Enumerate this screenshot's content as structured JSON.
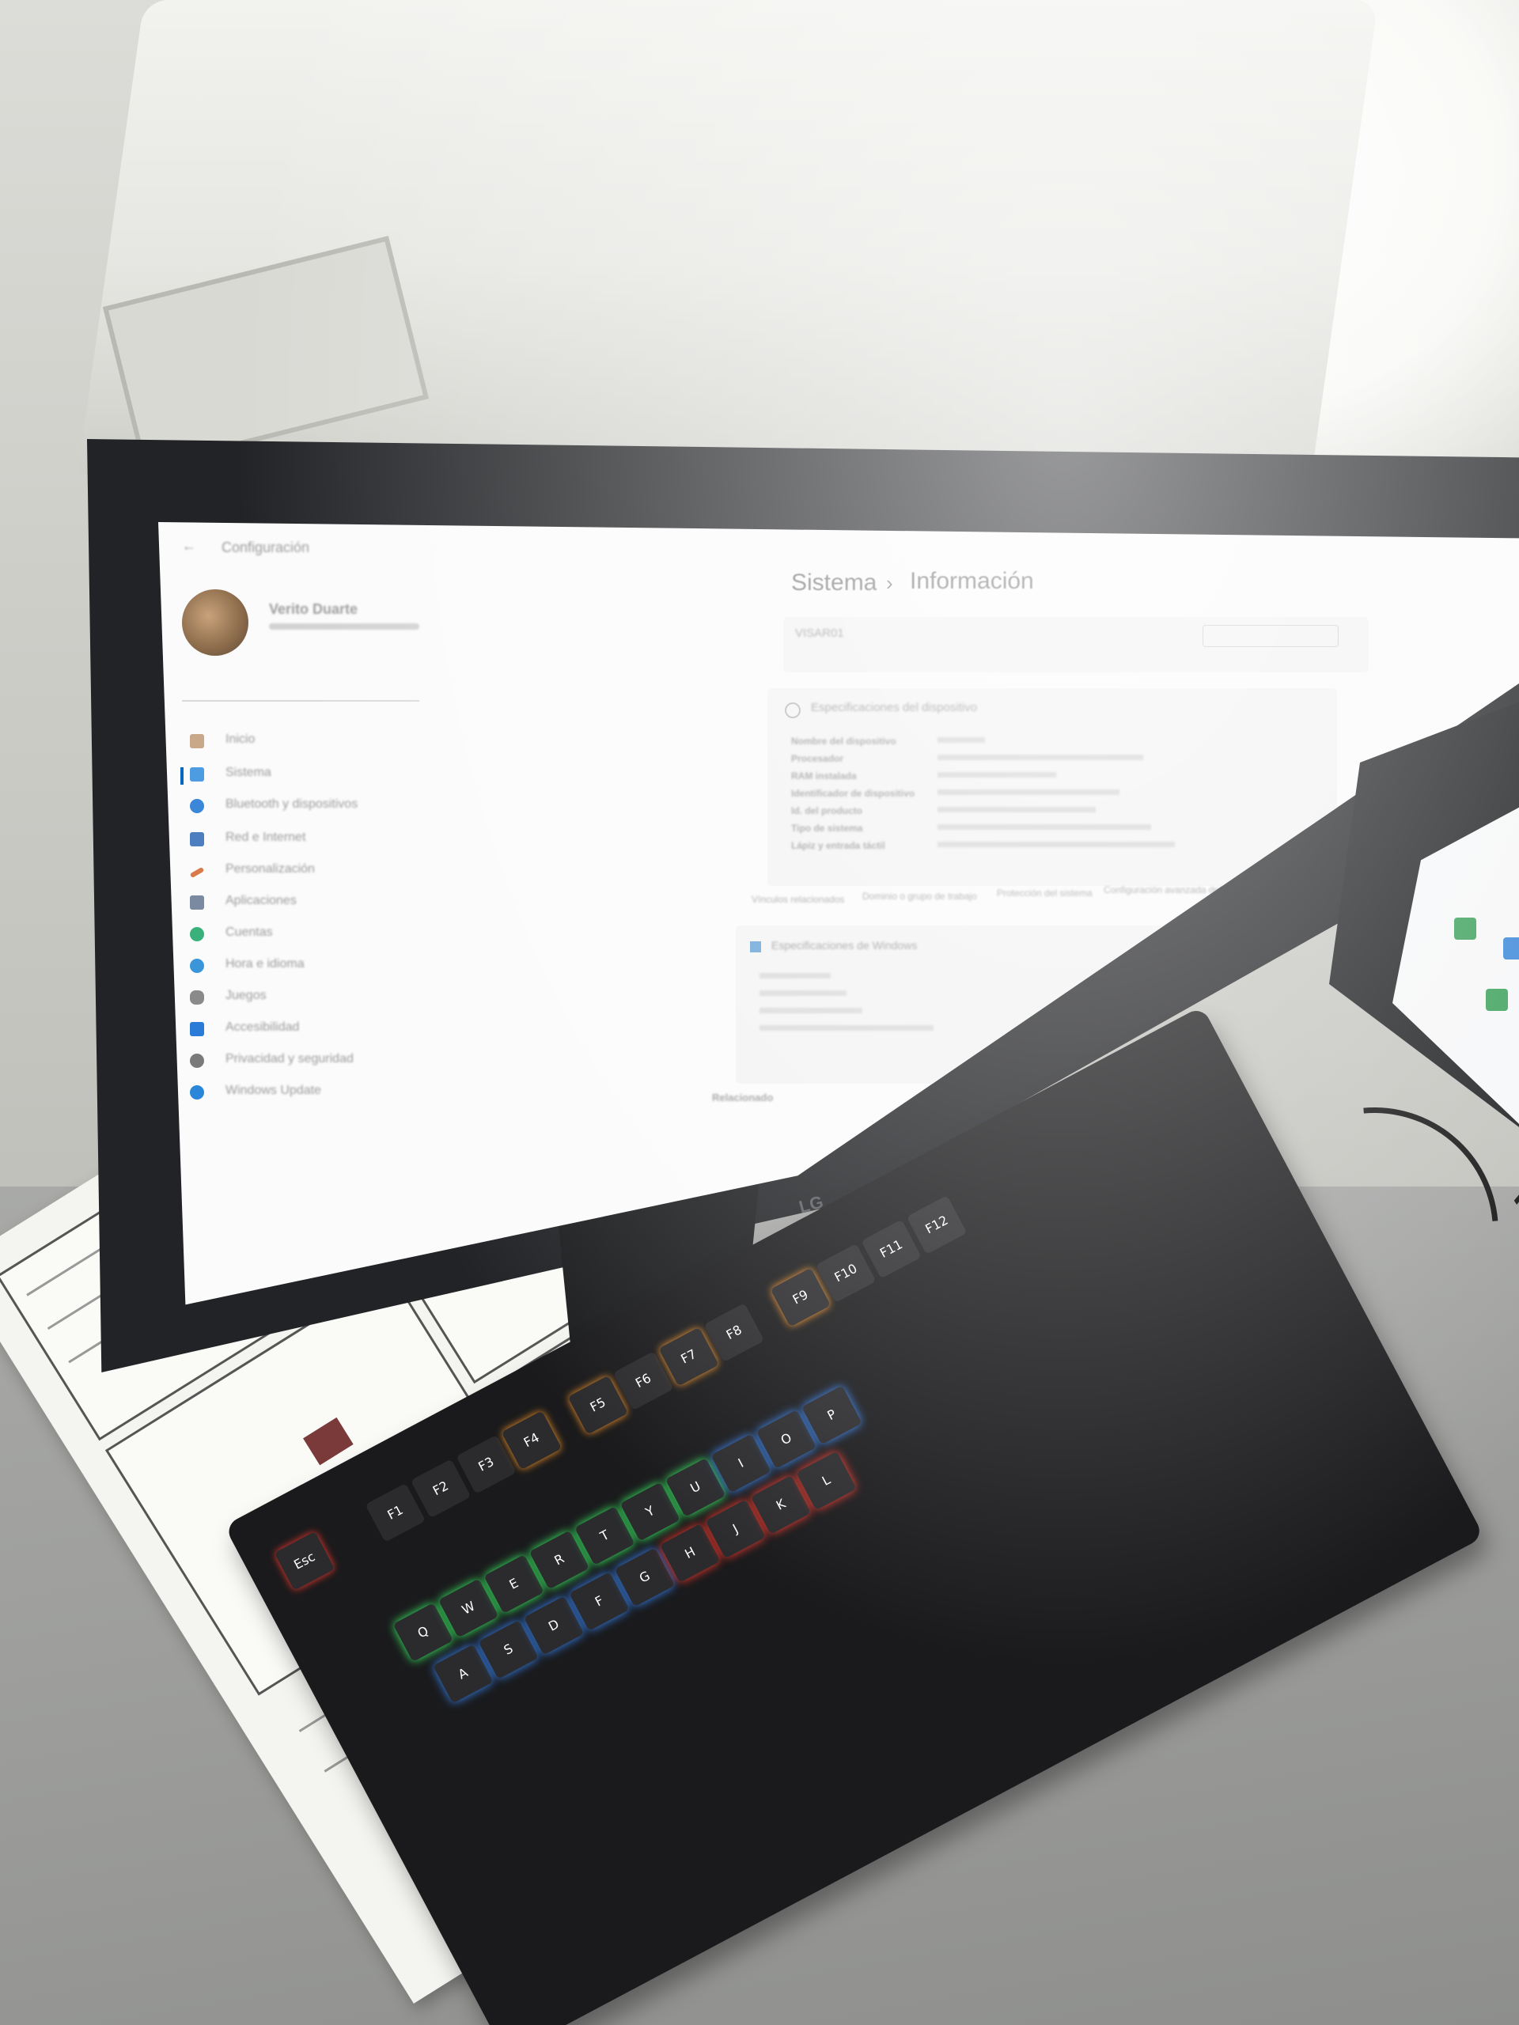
{
  "settings": {
    "app_title": "Configuración",
    "breadcrumb_root": "Sistema",
    "breadcrumb_separator": "›",
    "breadcrumb_page": "Información",
    "user_name": "Verito Duarte",
    "device_name": "VISAR01",
    "spec_section_title": "Especificaciones del dispositivo",
    "windows_section_title": "Especificaciones de Windows",
    "related_title": "Relacionado",
    "spec_labels": [
      "Nombre del dispositivo",
      "Procesador",
      "RAM instalada",
      "Identificador de dispositivo",
      "Id. del producto",
      "Tipo de sistema",
      "Lápiz y entrada táctil"
    ],
    "nav_items": [
      "Inicio",
      "Sistema",
      "Bluetooth y dispositivos",
      "Red e Internet",
      "Personalización",
      "Aplicaciones",
      "Cuentas",
      "Hora e idioma",
      "Juegos",
      "Accesibilidad",
      "Privacidad y seguridad",
      "Windows Update"
    ],
    "tabs": [
      "Vínculos relacionados",
      "Dominio o grupo de trabajo",
      "Protección del sistema",
      "Configuración avanzada del sistema"
    ]
  },
  "keyboard": {
    "keys": [
      "Esc",
      "F1",
      "F2",
      "F3",
      "F4",
      "F5",
      "F6",
      "F7",
      "F8",
      "F9",
      "F10",
      "F11",
      "F12",
      "Q",
      "W",
      "E",
      "R",
      "T",
      "Y",
      "U",
      "I",
      "O",
      "P",
      "A",
      "S",
      "D",
      "F",
      "G",
      "H",
      "J",
      "K",
      "L"
    ]
  },
  "monitor": {
    "logo": "LG"
  },
  "colors": {
    "accent": "#0067c0",
    "key_glow_red": "#ff3b2f",
    "key_glow_green": "#3cff6a",
    "key_glow_blue": "#3a8bff",
    "key_glow_orange": "#ff9a2a"
  }
}
